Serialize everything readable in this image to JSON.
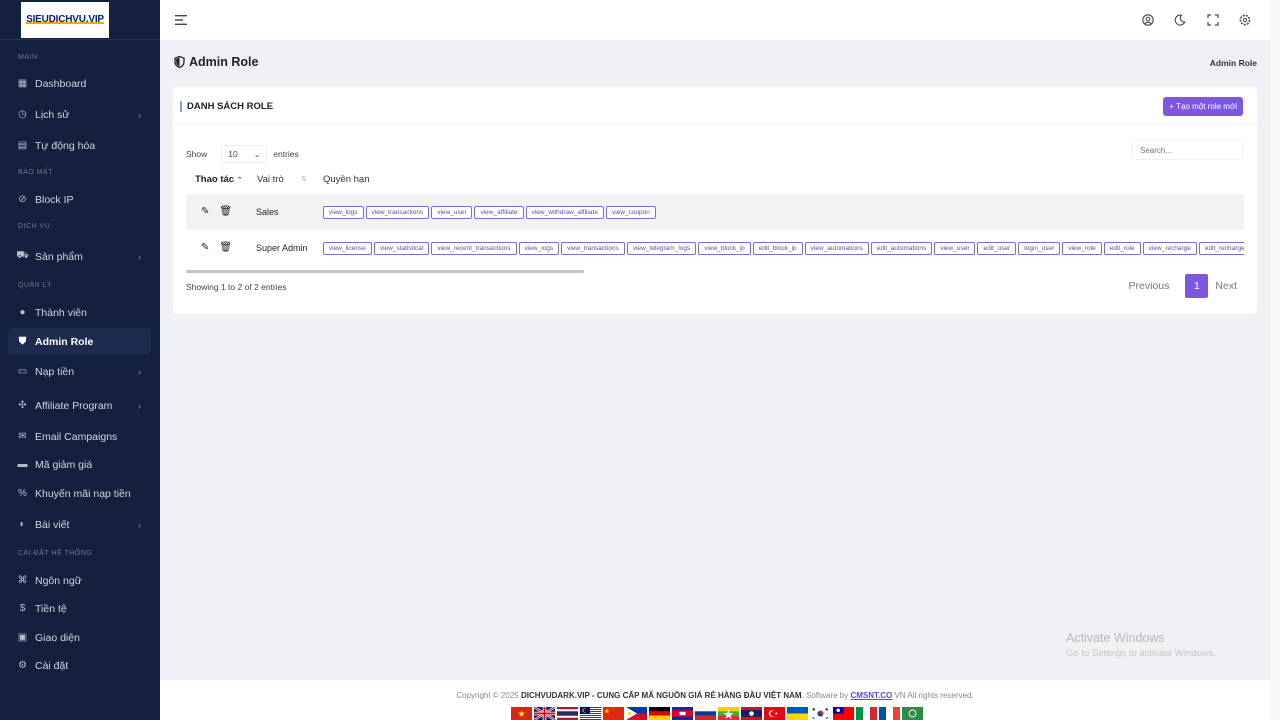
{
  "sidebar": {
    "logo_text": "SIEUDICHVU.VIP",
    "sections": {
      "main": "MAIN",
      "security": "BẢO MẬT",
      "service": "DỊCH VỤ",
      "manage": "QUẢN LÝ",
      "settings": "CÀI ĐẶT HỆ THỐNG"
    },
    "items": {
      "dashboard": "Dashboard",
      "history": "Lịch sử",
      "automation": "Tự động hóa",
      "block_ip": "Block IP",
      "products": "Sản phẩm",
      "members": "Thành viên",
      "admin_role": "Admin Role",
      "recharge": "Nạp tiền",
      "affiliate": "Affiliate Program",
      "email": "Email Campaigns",
      "coupon": "Mã giảm giá",
      "promo": "Khuyến mãi nạp tiền",
      "posts": "Bài viết",
      "language": "Ngôn ngữ",
      "currency": "Tiền tệ",
      "theme": "Giao diện",
      "settings": "Cài đặt"
    }
  },
  "page": {
    "title": "Admin Role",
    "breadcrumb": "Admin Role"
  },
  "card": {
    "title": "DANH SÁCH ROLE",
    "new_button": "+ Tạo một role mới",
    "show_label": "Show",
    "entries_value": "10",
    "entries_label": "entries",
    "search_placeholder": "Search...",
    "columns": {
      "actions": "Thao tác",
      "role": "Vai trò",
      "permissions": "Quyền hạn"
    },
    "rows": [
      {
        "role": "Sales",
        "permissions": [
          "view_logs",
          "view_transactions",
          "view_user",
          "view_affiliate",
          "view_withdraw_affiliate",
          "view_coupon"
        ]
      },
      {
        "role": "Super Admin",
        "permissions": [
          "view_license",
          "view_statistical",
          "view_recent_transactions",
          "view_logs",
          "view_transactions",
          "view_telegram_logs",
          "view_block_ip",
          "edit_block_ip",
          "view_automations",
          "edit_automations",
          "view_user",
          "edit_user",
          "login_user",
          "view_role",
          "edit_role",
          "view_recharge",
          "edit_recharge"
        ]
      }
    ],
    "showing": "Showing 1 to 2 of 2 entries",
    "pager": {
      "previous": "Previous",
      "page": "1",
      "next": "Next"
    }
  },
  "watermark": {
    "line1": "Activate Windows",
    "line2": "Go to Settings to activate Windows."
  },
  "footer": {
    "prefix": "Copyright © 2025",
    "site": "DICHVUDARK.VIP - CUNG CẤP MÃ NGUỒN GIÁ RẺ HÀNG ĐẦU VIỆT NAM",
    "software": ". Software by",
    "brand": "CMSNT.CO",
    "suffix": "VN All rights reserved."
  },
  "colors": {
    "accent": "#7e57e0",
    "sidebar_bg": "#14213e"
  }
}
